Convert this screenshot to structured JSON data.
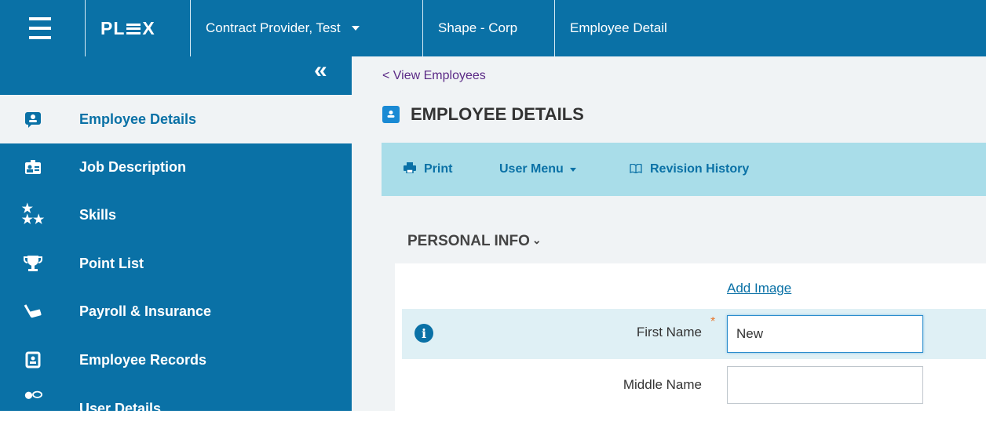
{
  "header": {
    "logo": "PL X",
    "logo_left": "PL",
    "logo_right": "X",
    "company": "Contract Provider, Test",
    "site": "Shape - Corp",
    "page": "Employee Detail"
  },
  "sidebar": {
    "collapse_label": "«",
    "items": [
      {
        "label": "Employee Details",
        "icon": "id-card-icon",
        "active": true
      },
      {
        "label": "Job Description",
        "icon": "badge-icon"
      },
      {
        "label": "Skills",
        "icon": "stars-icon"
      },
      {
        "label": "Point List",
        "icon": "trophy-icon"
      },
      {
        "label": "Payroll & Insurance",
        "icon": "money-icon"
      },
      {
        "label": "Employee Records",
        "icon": "records-icon"
      },
      {
        "label": "User Details",
        "icon": "user-chat-icon"
      }
    ]
  },
  "main": {
    "back_link": "< View Employees",
    "title": "EMPLOYEE DETAILS",
    "toolbar": {
      "print": "Print",
      "user_menu": "User Menu",
      "revision_history": "Revision History"
    },
    "section_title": "PERSONAL INFO",
    "add_image": "Add Image",
    "fields": {
      "first_name_label": "First Name",
      "first_name_value": "New",
      "required_mark": "*",
      "middle_name_label": "Middle Name",
      "middle_name_value": ""
    }
  },
  "colors": {
    "primary": "#0a71a6",
    "toolbar": "#a9dde9",
    "background": "#f0f3f5",
    "link_purple": "#5b2a86",
    "required": "#e8762b"
  }
}
